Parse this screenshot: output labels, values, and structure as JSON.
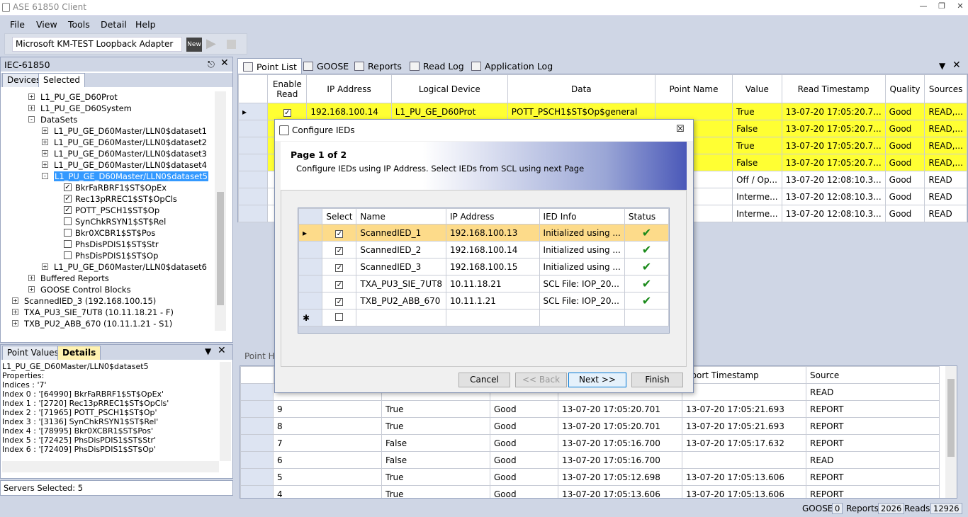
{
  "app": {
    "title": "ASE 61850 Client"
  },
  "menu": [
    "File",
    "View",
    "Tools",
    "Detail",
    "Help"
  ],
  "toolbar": {
    "adapter": "Microsoft KM-TEST Loopback Adapter",
    "new_label": "New"
  },
  "left": {
    "title": "IEC-61850",
    "tabs": [
      "Devices",
      "Selected"
    ],
    "tree": [
      {
        "label": "L1_PU_GE_D60Prot",
        "lvl": 2,
        "exp": "+"
      },
      {
        "label": "L1_PU_GE_D60System",
        "lvl": 2,
        "exp": "+"
      },
      {
        "label": "DataSets",
        "lvl": 2,
        "exp": "-"
      },
      {
        "label": "L1_PU_GE_D60Master/LLN0$dataset1",
        "lvl": 3,
        "exp": "+"
      },
      {
        "label": "L1_PU_GE_D60Master/LLN0$dataset2",
        "lvl": 3,
        "exp": "+"
      },
      {
        "label": "L1_PU_GE_D60Master/LLN0$dataset3",
        "lvl": 3,
        "exp": "+"
      },
      {
        "label": "L1_PU_GE_D60Master/LLN0$dataset4",
        "lvl": 3,
        "exp": "+"
      },
      {
        "label": "L1_PU_GE_D60Master/LLN0$dataset5",
        "lvl": 3,
        "exp": "-",
        "hl": true
      },
      {
        "label": "BkrFaRBRF1$ST$OpEx",
        "lvl": 4,
        "cb": true
      },
      {
        "label": "Rec13pRREC1$ST$OpCls",
        "lvl": 4,
        "cb": true
      },
      {
        "label": "POTT_PSCH1$ST$Op",
        "lvl": 4,
        "cb": true
      },
      {
        "label": "SynChkRSYN1$ST$Rel",
        "lvl": 4,
        "cb": false
      },
      {
        "label": "Bkr0XCBR1$ST$Pos",
        "lvl": 4,
        "cb": false
      },
      {
        "label": "PhsDisPDIS1$ST$Str",
        "lvl": 4,
        "cb": false
      },
      {
        "label": "PhsDisPDIS1$ST$Op",
        "lvl": 4,
        "cb": false
      },
      {
        "label": "L1_PU_GE_D60Master/LLN0$dataset6",
        "lvl": 3,
        "exp": "+"
      },
      {
        "label": "Buffered Reports",
        "lvl": 2,
        "exp": "+"
      },
      {
        "label": "GOOSE Control Blocks",
        "lvl": 2,
        "exp": "+"
      },
      {
        "label": "ScannedIED_3 (192.168.100.15)",
        "lvl": 0,
        "exp": "+"
      },
      {
        "label": "TXA_PU3_SIE_7UT8 (10.11.18.21 - F)",
        "lvl": 0,
        "exp": "+"
      },
      {
        "label": "TXB_PU2_ABB_670 (10.11.1.21 - S1)",
        "lvl": 0,
        "exp": "+"
      }
    ],
    "bottom_tabs": [
      "Point Values",
      "Details"
    ],
    "details": [
      "L1_PU_GE_D60Master/LLN0$dataset5",
      "Properties:",
      "Indices : '7'",
      "Index 0 : '[64990] BkrFaRBRF1$ST$OpEx'",
      "Index 1 : '[2720] Rec13pRREC1$ST$OpCls'",
      "Index 2 : '[71965] POTT_PSCH1$ST$Op'",
      "Index 3 : '[3136] SynChkRSYN1$ST$Rel'",
      "Index 4 : '[78995] Bkr0XCBR1$ST$Pos'",
      "Index 5 : '[72425] PhsDisPDIS1$ST$Str'",
      "Index 6 : '[72409] PhsDisPDIS1$ST$Op'"
    ],
    "servers_selected": "Servers Selected: 5"
  },
  "main_tabs": [
    "Point List",
    "GOOSE",
    "Reports",
    "Read Log",
    "Application Log"
  ],
  "points": {
    "headers": [
      "Enable Read",
      "IP Address",
      "Logical Device",
      "Data",
      "Point Name",
      "Value",
      "Read Timestamp",
      "Quality",
      "Sources"
    ],
    "rows": [
      {
        "ip": "192.168.100.14",
        "ld": "L1_PU_GE_D60Prot",
        "data": "POTT_PSCH1$ST$Op$general",
        "value": "True",
        "ts": "13-07-20 17:05:20.7...",
        "q": "Good",
        "src": "READ,...",
        "y": true
      },
      {
        "ip": "",
        "ld": "",
        "data": "",
        "value": "False",
        "ts": "13-07-20 17:05:20.7...",
        "q": "Good",
        "src": "READ,...",
        "y": true
      },
      {
        "ip": "",
        "ld": "",
        "data": "",
        "value": "True",
        "ts": "13-07-20 17:05:20.7...",
        "q": "Good",
        "src": "READ,...",
        "y": true
      },
      {
        "ip": "",
        "ld": "",
        "data": "",
        "value": "False",
        "ts": "13-07-20 17:05:20.7...",
        "q": "Good",
        "src": "READ,...",
        "y": true
      },
      {
        "ip": "",
        "ld": "",
        "data": "",
        "value": "Off / Op...",
        "ts": "13-07-20 12:08:10.3...",
        "q": "Good",
        "src": "READ",
        "y": false
      },
      {
        "ip": "",
        "ld": "",
        "data": "",
        "value": "Interme...",
        "ts": "13-07-20 12:08:10.3...",
        "q": "Good",
        "src": "READ",
        "y": false
      },
      {
        "ip": "",
        "ld": "",
        "data": "",
        "value": "Interme...",
        "ts": "13-07-20 12:08:10.3...",
        "q": "Good",
        "src": "READ",
        "y": false
      }
    ]
  },
  "history": {
    "label": "Point Hi",
    "headers": [
      "",
      "",
      "",
      "",
      "eport Timestamp",
      "Source"
    ],
    "rows": [
      {
        "n": "",
        "v": "",
        "q": "",
        "t1": "",
        "t2": "",
        "s": "READ"
      },
      {
        "n": "9",
        "v": "True",
        "q": "Good",
        "t1": "13-07-20 17:05:20.701",
        "t2": "13-07-20 17:05:21.693",
        "s": "REPORT"
      },
      {
        "n": "8",
        "v": "True",
        "q": "Good",
        "t1": "13-07-20 17:05:20.701",
        "t2": "13-07-20 17:05:21.693",
        "s": "REPORT"
      },
      {
        "n": "7",
        "v": "False",
        "q": "Good",
        "t1": "13-07-20 17:05:16.700",
        "t2": "13-07-20 17:05:17.632",
        "s": "REPORT"
      },
      {
        "n": "6",
        "v": "False",
        "q": "Good",
        "t1": "13-07-20 17:05:16.700",
        "t2": "",
        "s": "READ"
      },
      {
        "n": "5",
        "v": "True",
        "q": "Good",
        "t1": "13-07-20 17:05:12.698",
        "t2": "13-07-20 17:05:13.606",
        "s": "REPORT"
      },
      {
        "n": "4",
        "v": "True",
        "q": "Good",
        "t1": "13-07-20 17:05:13.606",
        "t2": "13-07-20 17:05:13.606",
        "s": "REPORT"
      }
    ]
  },
  "dialog": {
    "title": "Configure IEDs",
    "page": "Page 1 of 2",
    "desc": "Configure IEDs using IP Address. Select IEDs from SCL using next Page",
    "headers": [
      "Select",
      "Name",
      "IP Address",
      "IED Info",
      "Status"
    ],
    "rows": [
      {
        "name": "ScannedIED_1",
        "ip": "192.168.100.13",
        "info": "Initialized using ...",
        "sel": true
      },
      {
        "name": "ScannedIED_2",
        "ip": "192.168.100.14",
        "info": "Initialized using ...",
        "sel": false
      },
      {
        "name": "ScannedIED_3",
        "ip": "192.168.100.15",
        "info": "Initialized using ...",
        "sel": false
      },
      {
        "name": "TXA_PU3_SIE_7UT8",
        "ip": "10.11.18.21",
        "info": "SCL File: IOP_20...",
        "sel": false
      },
      {
        "name": "TXB_PU2_ABB_670",
        "ip": "10.11.1.21",
        "info": "SCL File: IOP_20...",
        "sel": false
      }
    ],
    "buttons": {
      "cancel": "Cancel",
      "back": "<< Back",
      "next": "Next >>",
      "finish": "Finish"
    }
  },
  "status": {
    "goose_label": "GOOSE",
    "goose": "0",
    "reports_label": "Reports",
    "reports": "2026",
    "reads_label": "Reads",
    "reads": "12926"
  },
  "colors": {
    "highlight_row": "#ffff33",
    "selected_row": "#fddb8a",
    "check": "#1a8a1a"
  }
}
